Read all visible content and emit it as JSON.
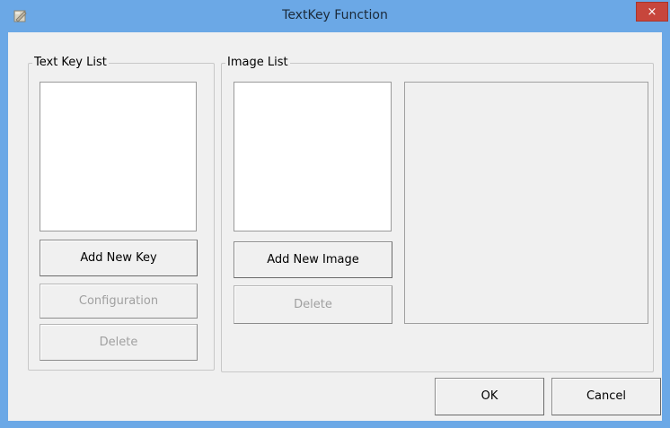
{
  "window": {
    "title": "TextKey Function",
    "close_glyph": "×",
    "app_icon": "app-icon"
  },
  "text_key_group": {
    "title": "Text Key List",
    "add_label": "Add New Key",
    "config_label": "Configuration",
    "delete_label": "Delete"
  },
  "image_group": {
    "title": "Image List",
    "add_label": "Add New Image",
    "delete_label": "Delete"
  },
  "footer": {
    "ok_label": "OK",
    "cancel_label": "Cancel"
  },
  "colors": {
    "titlebar": "#6ba8e6",
    "close": "#c7463c",
    "dialog_bg": "#f0f0f0",
    "disabled_text": "#a0a0a0"
  }
}
